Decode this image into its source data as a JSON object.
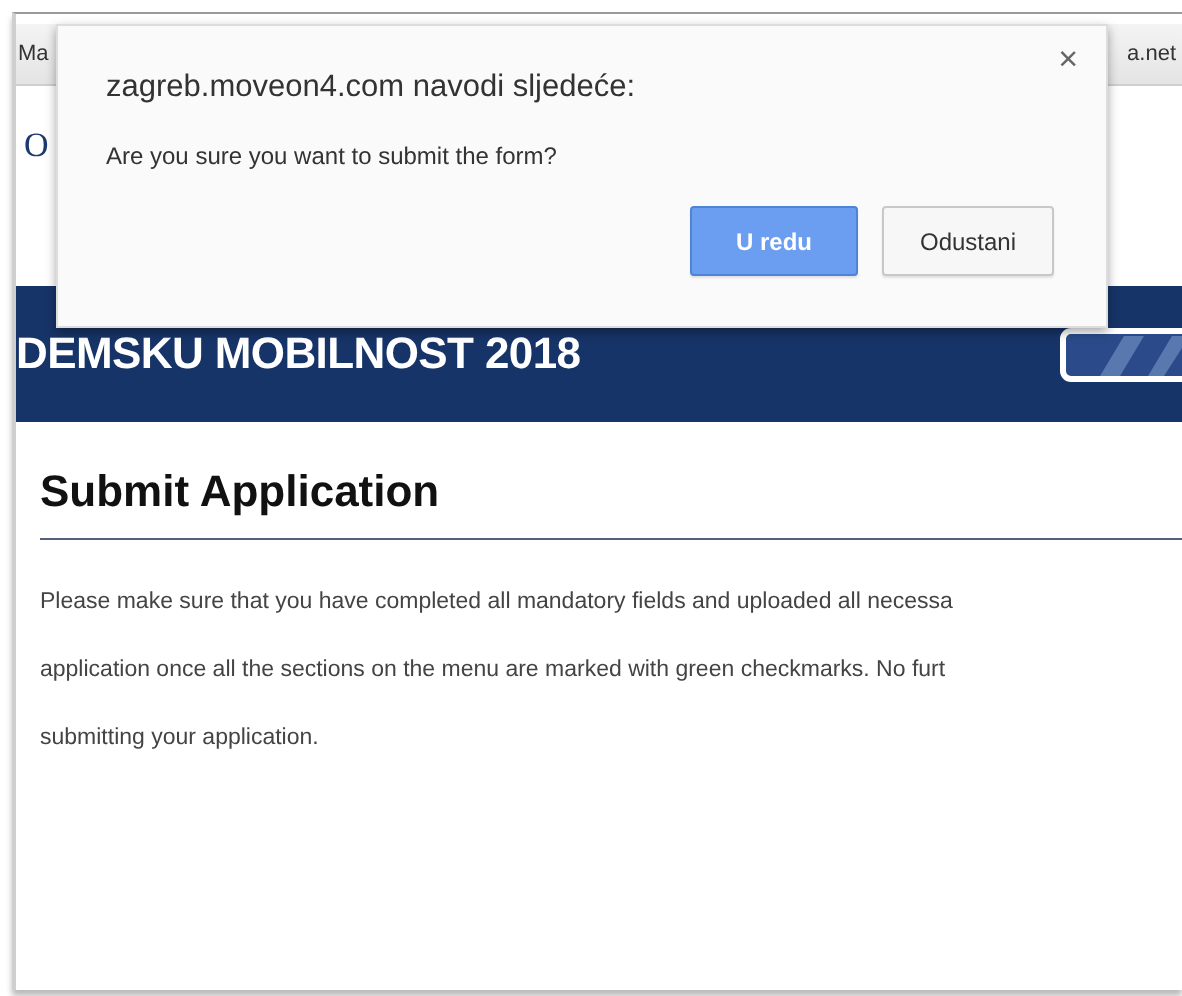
{
  "bookmarks_bar": {
    "left_text": "Ma",
    "right_text": "a.net"
  },
  "page": {
    "logo_letter": "O",
    "banner": {
      "title": "DEMSKU MOBILNOST 2018"
    },
    "section": {
      "heading": "Submit Application",
      "lines": [
        "Please make sure that you have completed all mandatory fields and uploaded all necessa",
        "application once all the sections on the menu are marked with green checkmarks. No furt",
        "submitting your application."
      ]
    }
  },
  "dialog": {
    "title": "zagreb.moveon4.com navodi sljedeće:",
    "message": "Are you sure you want to submit the form?",
    "close": "×",
    "buttons": [
      {
        "label": "U redu",
        "kind": "primary"
      },
      {
        "label": "Odustani",
        "kind": "secondary"
      }
    ]
  }
}
